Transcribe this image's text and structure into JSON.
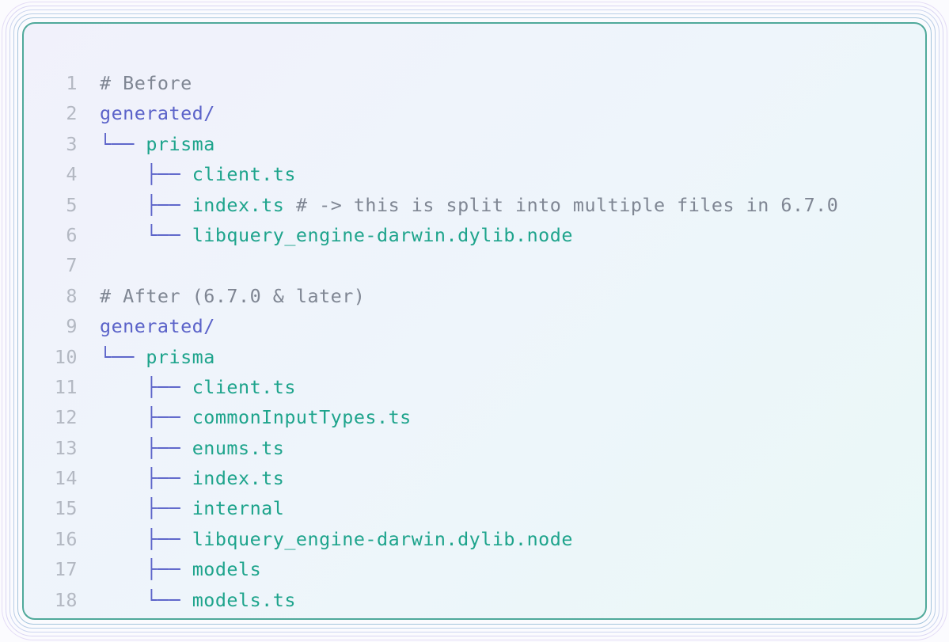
{
  "code": {
    "lines": [
      {
        "number": "1",
        "indent": "",
        "branch": "",
        "name": "",
        "name_kind": "none",
        "comment": "# Before"
      },
      {
        "number": "2",
        "indent": "",
        "branch": "",
        "name": "generated/",
        "name_kind": "dir",
        "comment": ""
      },
      {
        "number": "3",
        "indent": "",
        "branch": "└── ",
        "name": "prisma",
        "name_kind": "file",
        "comment": ""
      },
      {
        "number": "4",
        "indent": "    ",
        "branch": "├── ",
        "name": "client.ts",
        "name_kind": "file",
        "comment": ""
      },
      {
        "number": "5",
        "indent": "    ",
        "branch": "├── ",
        "name": "index.ts",
        "name_kind": "file",
        "comment": " # -> this is split into multiple files in 6.7.0"
      },
      {
        "number": "6",
        "indent": "    ",
        "branch": "└── ",
        "name": "libquery_engine-darwin.dylib.node",
        "name_kind": "file",
        "comment": ""
      },
      {
        "number": "7",
        "indent": "",
        "branch": "",
        "name": "",
        "name_kind": "none",
        "comment": ""
      },
      {
        "number": "8",
        "indent": "",
        "branch": "",
        "name": "",
        "name_kind": "none",
        "comment": "# After (6.7.0 & later)"
      },
      {
        "number": "9",
        "indent": "",
        "branch": "",
        "name": "generated/",
        "name_kind": "dir",
        "comment": ""
      },
      {
        "number": "10",
        "indent": "",
        "branch": "└── ",
        "name": "prisma",
        "name_kind": "file",
        "comment": ""
      },
      {
        "number": "11",
        "indent": "    ",
        "branch": "├── ",
        "name": "client.ts",
        "name_kind": "file",
        "comment": ""
      },
      {
        "number": "12",
        "indent": "    ",
        "branch": "├── ",
        "name": "commonInputTypes.ts",
        "name_kind": "file",
        "comment": ""
      },
      {
        "number": "13",
        "indent": "    ",
        "branch": "├── ",
        "name": "enums.ts",
        "name_kind": "file",
        "comment": ""
      },
      {
        "number": "14",
        "indent": "    ",
        "branch": "├── ",
        "name": "index.ts",
        "name_kind": "file",
        "comment": ""
      },
      {
        "number": "15",
        "indent": "    ",
        "branch": "├── ",
        "name": "internal",
        "name_kind": "file",
        "comment": ""
      },
      {
        "number": "16",
        "indent": "    ",
        "branch": "├── ",
        "name": "libquery_engine-darwin.dylib.node",
        "name_kind": "file",
        "comment": ""
      },
      {
        "number": "17",
        "indent": "    ",
        "branch": "├── ",
        "name": "models",
        "name_kind": "file",
        "comment": ""
      },
      {
        "number": "18",
        "indent": "    ",
        "branch": "└── ",
        "name": "models.ts",
        "name_kind": "file",
        "comment": ""
      }
    ]
  },
  "colors": {
    "line_number": "#b3b8c2",
    "comment": "#7f8693",
    "directory": "#5b63c9",
    "file": "#1ea48c",
    "tree_branch": "#5b63c9",
    "card_border": "#4fa99a"
  }
}
